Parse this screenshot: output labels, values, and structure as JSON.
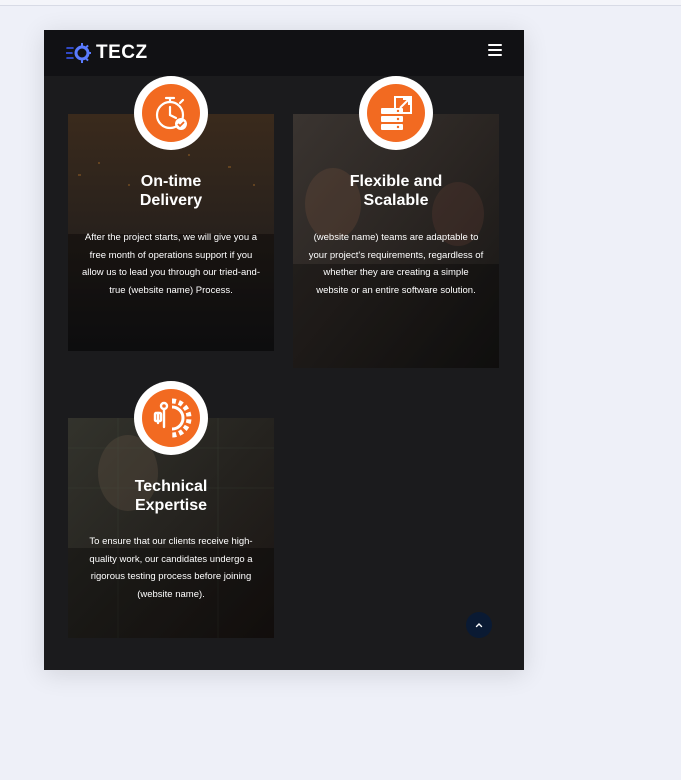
{
  "brand": {
    "name": "TECZ",
    "accent": "#f26a21"
  },
  "header": {
    "menu_icon": "hamburger-icon"
  },
  "cards": [
    {
      "title": "On-time\nDelivery",
      "description": "After the project starts, we will give you a free month of operations support if you allow us to lead you through our tried-and-true (website name) Process.",
      "icon": "stopwatch-icon"
    },
    {
      "title": "Flexible and\nScalable",
      "description": "(website name) teams are adaptable to your project's requirements, regardless of whether they are creating a simple website or an entire software solution.",
      "icon": "server-scale-icon"
    },
    {
      "title": "Technical\nExpertise",
      "description": "To ensure that our clients receive high-quality work, our candidates undergo a rigorous testing process before joining (website name).",
      "icon": "tools-gear-icon"
    }
  ],
  "scroll_top": {
    "icon": "chevron-up-icon"
  }
}
